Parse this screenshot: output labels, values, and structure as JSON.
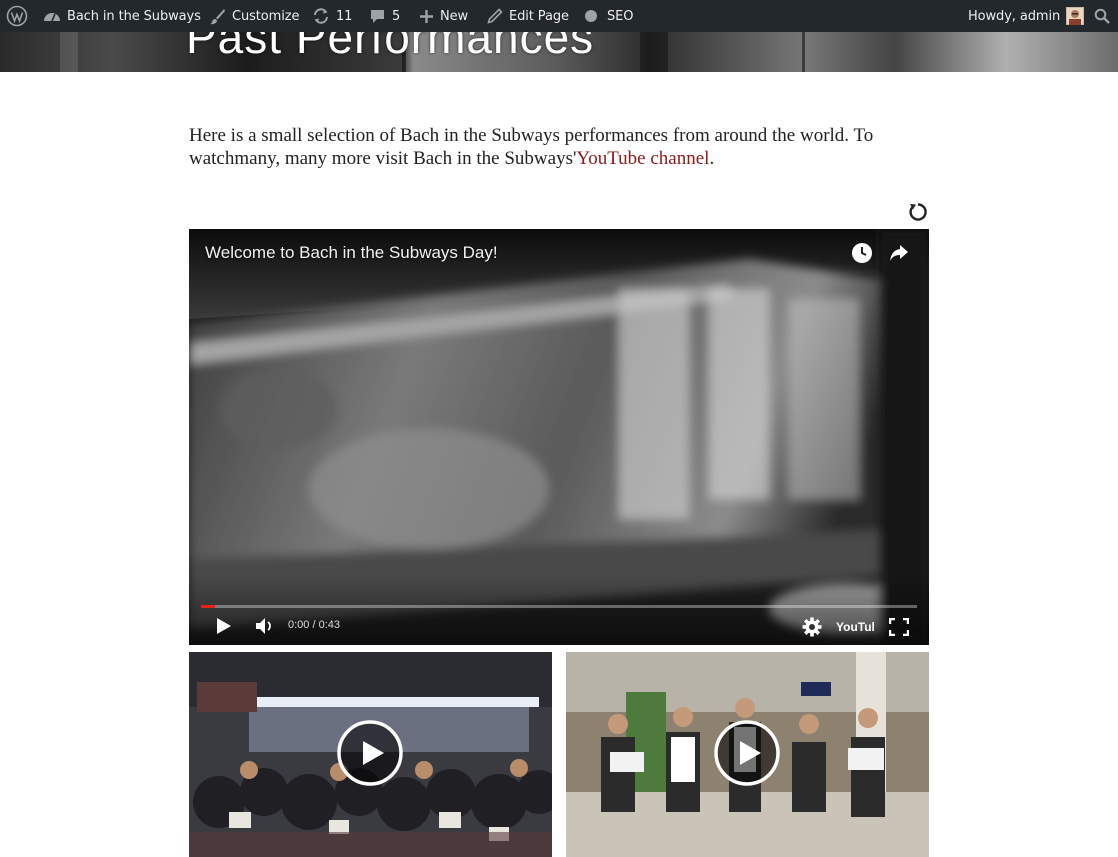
{
  "admin_bar": {
    "site_name": "Bach in the Subways",
    "customize": "Customize",
    "updates_count": "11",
    "comments_count": "5",
    "new": "New",
    "edit_page": "Edit Page",
    "seo": "SEO",
    "greeting": "Howdy, admin",
    "icons": [
      "wordpress-logo-icon",
      "dashboard-icon",
      "brush-icon",
      "updates-icon",
      "comment-icon",
      "plus-icon",
      "pencil-icon",
      "seo-dot-icon",
      "search-icon"
    ]
  },
  "header": {
    "title": "Past Performances"
  },
  "intro": {
    "text_part1": "Here is a small selection of Bach in the Subways performances from around the world. To watchmany, many more visit Bach in the Subways'",
    "link_text": "YouTube channel",
    "text_part2": "."
  },
  "main_video": {
    "title": "Welcome to Bach in the Subways Day!",
    "time": "0:00 / 0:43",
    "progress": 0.02,
    "logo": "YouTube"
  },
  "thumbnails": [
    {
      "kind": "subway-platform-crowd"
    },
    {
      "kind": "airport-singers"
    }
  ],
  "colors": {
    "admin_bar": "#23282d",
    "link": "#8b1a1a",
    "progress": "#e62117"
  }
}
